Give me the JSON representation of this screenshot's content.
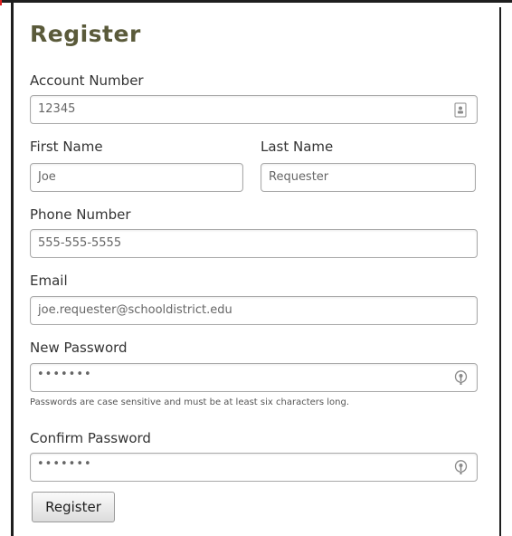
{
  "form": {
    "title": "Register",
    "account_number": {
      "label": "Account Number",
      "value": "12345",
      "icon": "contact-card-icon"
    },
    "first_name": {
      "label": "First Name",
      "value": "Joe"
    },
    "last_name": {
      "label": "Last Name",
      "value": "Requester"
    },
    "phone": {
      "label": "Phone Number",
      "value": "555-555-5555"
    },
    "email": {
      "label": "Email",
      "value": "joe.requester@schooldistrict.edu"
    },
    "new_password": {
      "label": "New Password",
      "value": "•••••••",
      "icon": "password-key-icon"
    },
    "password_help": "Passwords are case sensitive and must be at least six characters long.",
    "confirm_password": {
      "label": "Confirm Password",
      "value": "•••••••",
      "icon": "password-key-icon"
    },
    "submit_label": "Register"
  },
  "colors": {
    "title": "#5a5a3a",
    "field_border": "#a9a9a9",
    "frame_border": "#1e1e1e",
    "accent_mark": "#e02020"
  }
}
